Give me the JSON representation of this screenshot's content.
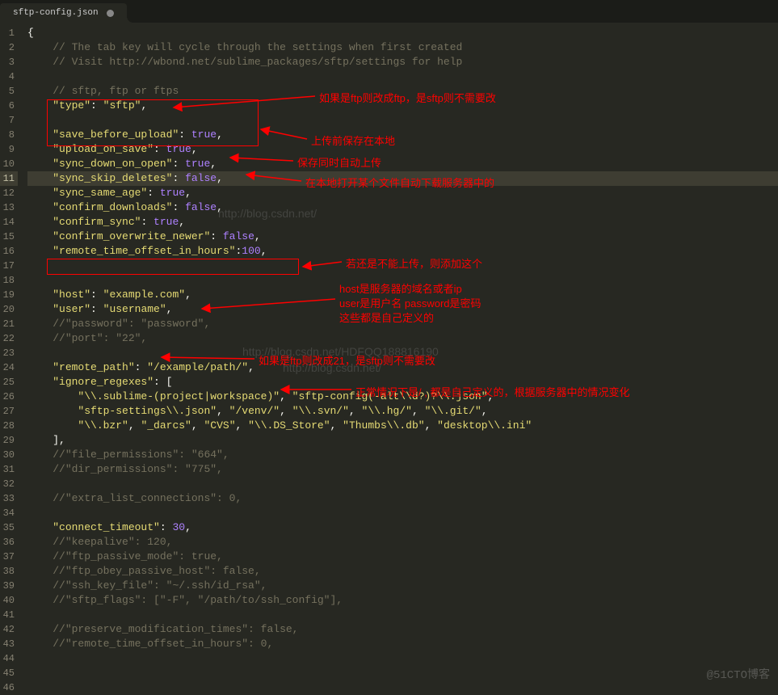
{
  "tab": {
    "filename": "sftp-config.json"
  },
  "lines": {
    "1": "1",
    "2": "2",
    "3": "3",
    "4": "4",
    "5": "5",
    "6": "6",
    "7": "7",
    "8": "8",
    "9": "9",
    "10": "10",
    "11": "11",
    "12": "12",
    "13": "13",
    "14": "14",
    "15": "15",
    "16": "16",
    "17": "17",
    "18": "18",
    "19": "19",
    "20": "20",
    "21": "21",
    "22": "22",
    "23": "23",
    "24": "24",
    "25": "25",
    "26": "26",
    "27": "27",
    "28": "28",
    "29": "29",
    "30": "30",
    "31": "31",
    "32": "32",
    "33": "33",
    "34": "34",
    "35": "35",
    "36": "36",
    "37": "37",
    "38": "38",
    "39": "39",
    "40": "40",
    "41": "41",
    "42": "42",
    "43": "43",
    "44": "44",
    "45": "45",
    "46": "46"
  },
  "code": {
    "brace": "{",
    "cmt1": "// The tab key will cycle through the settings when first created",
    "cmt2": "// Visit http://wbond.net/sublime_packages/sftp/settings for help",
    "cmt3": "// sftp, ftp or ftps",
    "type_k": "\"type\"",
    "type_v": "\"sftp\"",
    "sbu_k": "\"save_before_upload\"",
    "true": "true",
    "false": "false",
    "uos_k": "\"upload_on_save\"",
    "sdo_k": "\"sync_down_on_open\"",
    "ssd_k": "\"sync_skip_deletes\"",
    "ssa_k": "\"sync_same_age\"",
    "cd_k": "\"confirm_downloads\"",
    "cs_k": "\"confirm_sync\"",
    "con_k": "\"confirm_overwrite_newer\"",
    "rtoi_k": "\"remote_time_offset_in_hours\"",
    "rtoi_v": "100",
    "host_k": "\"host\"",
    "host_v": "\"example.com\"",
    "user_k": "\"user\"",
    "user_v": "\"username\"",
    "pwd_cmt": "//\"password\": \"password\",",
    "port_cmt": "//\"port\": \"22\",",
    "rp_k": "\"remote_path\"",
    "rp_v": "\"/example/path/\"",
    "ir_k": "\"ignore_regexes\"",
    "ir1_a": "\"\\\\.sublime-(project|workspace)\"",
    "ir1_b": "\"sftp-config(-alt\\\\d?)?\\\\.json\"",
    "ir2_a": "\"sftp-settings\\\\.json\"",
    "ir2_b": "\"/venv/\"",
    "ir2_c": "\"\\\\.svn/\"",
    "ir2_d": "\"\\\\.hg/\"",
    "ir2_e": "\"\\\\.git/\"",
    "ir3_a": "\"\\\\.bzr\"",
    "ir3_b": "\"_darcs\"",
    "ir3_c": "\"CVS\"",
    "ir3_d": "\"\\\\.DS_Store\"",
    "ir3_e": "\"Thumbs\\\\.db\"",
    "ir3_f": "\"desktop\\\\.ini\"",
    "fp_cmt": "//\"file_permissions\": \"664\",",
    "dp_cmt": "//\"dir_permissions\": \"775\",",
    "elc_cmt": "//\"extra_list_connections\": 0,",
    "ct_k": "\"connect_timeout\"",
    "ct_v": "30",
    "ka_cmt": "//\"keepalive\": 120,",
    "fpm_cmt": "//\"ftp_passive_mode\": true,",
    "foph_cmt": "//\"ftp_obey_passive_host\": false,",
    "skf_cmt": "//\"ssh_key_file\": \"~/.ssh/id_rsa\",",
    "sf_cmt": "//\"sftp_flags\": [\"-F\", \"/path/to/ssh_config\"],",
    "pmt_cmt": "//\"preserve_modification_times\": false,",
    "rtoi_cmt": "//\"remote_time_offset_in_hours\": 0,",
    "colon": ": ",
    "comma": ",",
    "lbrack": ": [",
    "rbrack": "],"
  },
  "anno": {
    "a1": "如果是ftp则改成ftp，是sftp则不需要改",
    "a2": "上传前保存在本地",
    "a3": "保存同时自动上传",
    "a4": "在本地打开某个文件自动下载服务器中的",
    "a5": "若还是不能上传，则添加这个",
    "a6": "host是服务器的域名或者ip",
    "a7": "user是用户名  password是密码",
    "a8": "这些都是自己定义的",
    "a9": "如果是ftp则改成21，是sftp则不需要改",
    "a10": "正常情况下是/ , 都是自己定义的，根据服务器中的情况变化"
  },
  "watermark": {
    "w1": "http://blog.csdn.net/",
    "w2": "http://blog.csdn.net/HDFQQ188816190",
    "w3": "http://blog.csdn.net/",
    "corner": "@51CTO博客"
  }
}
